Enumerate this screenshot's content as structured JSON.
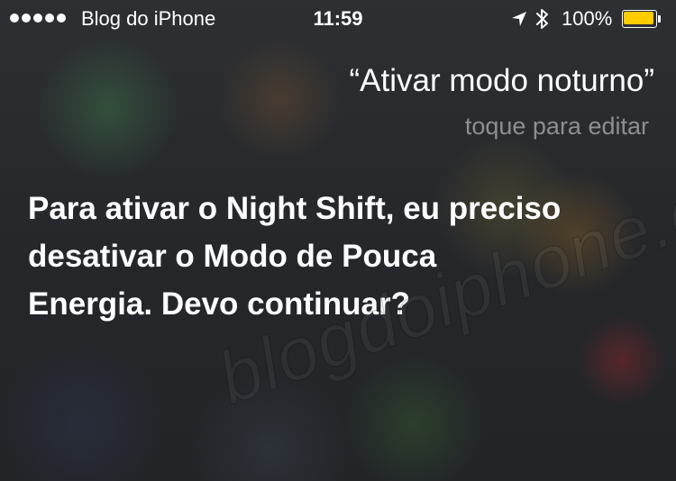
{
  "status_bar": {
    "carrier": "Blog do iPhone",
    "signal_dots": 5,
    "time": "11:59",
    "location_icon": "location-arrow-icon",
    "bluetooth_icon": "bluetooth-icon",
    "battery_percent": "100%",
    "battery_level": 1.0,
    "battery_color": "#ffcc00"
  },
  "siri": {
    "query": "“Ativar modo noturno”",
    "edit_hint": "toque para editar",
    "response": "Para ativar o Night Shift, eu preciso desativar o Modo de Pouca Energia. Devo continuar?"
  },
  "watermark": "blogdoiphone.com",
  "colors": {
    "edit_hint": "#8e8e93",
    "text": "#ffffff"
  }
}
